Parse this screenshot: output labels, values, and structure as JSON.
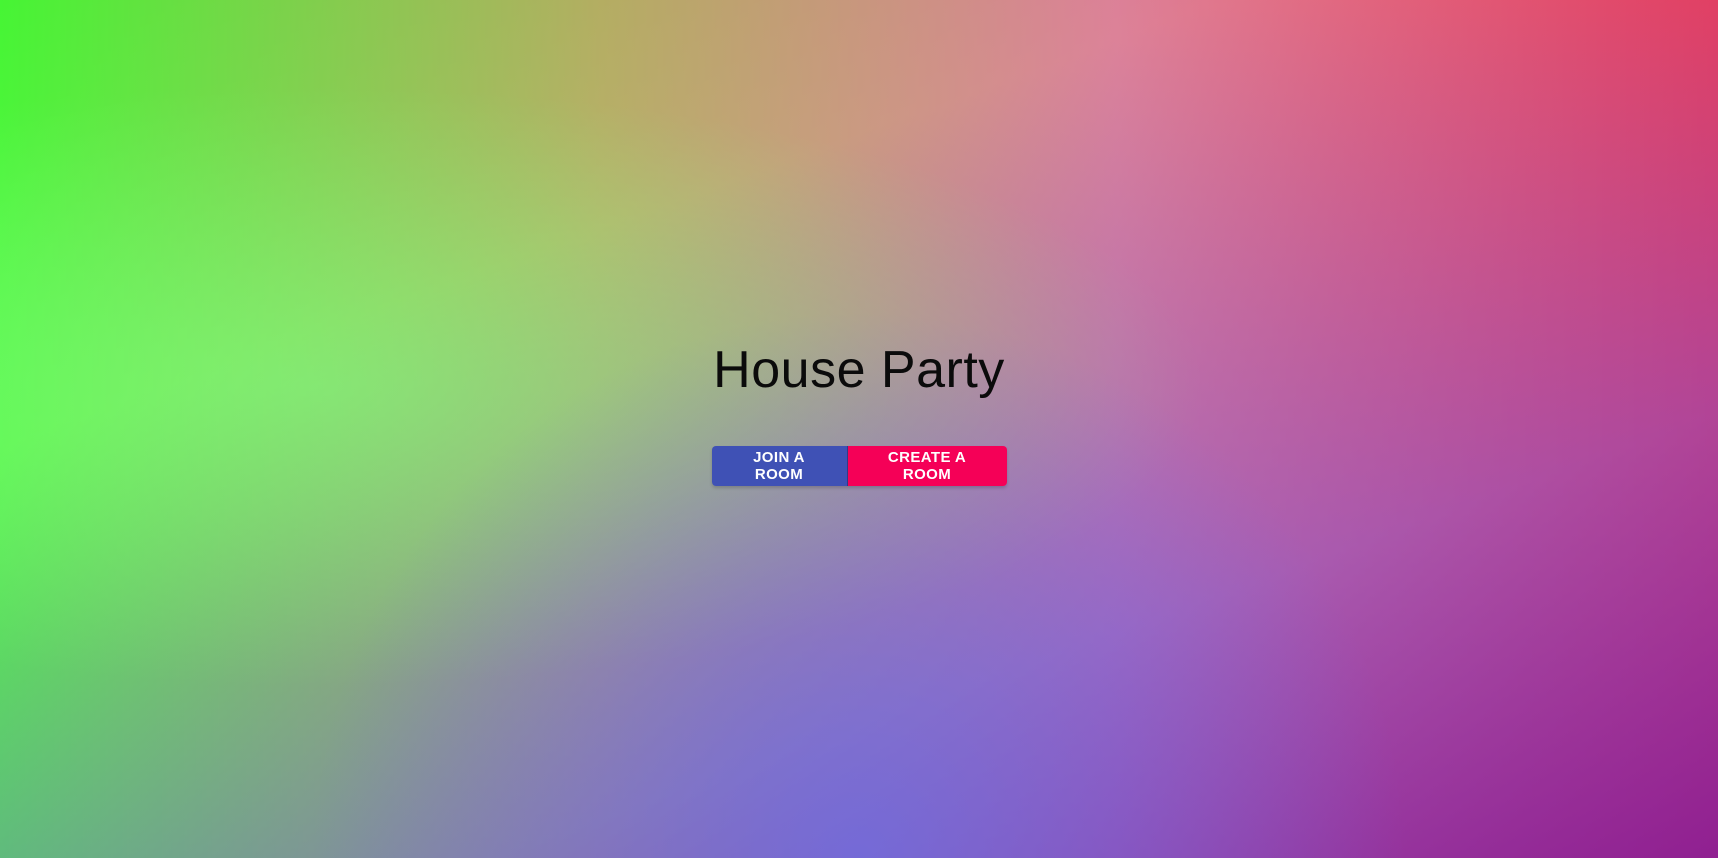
{
  "page": {
    "title": "House Party"
  },
  "actions": {
    "join_label": "JOIN A ROOM",
    "create_label": "CREATE A ROOM"
  },
  "colors": {
    "join_button": "#3f51b5",
    "create_button": "#f50057",
    "title_text": "#0b0b0b"
  }
}
